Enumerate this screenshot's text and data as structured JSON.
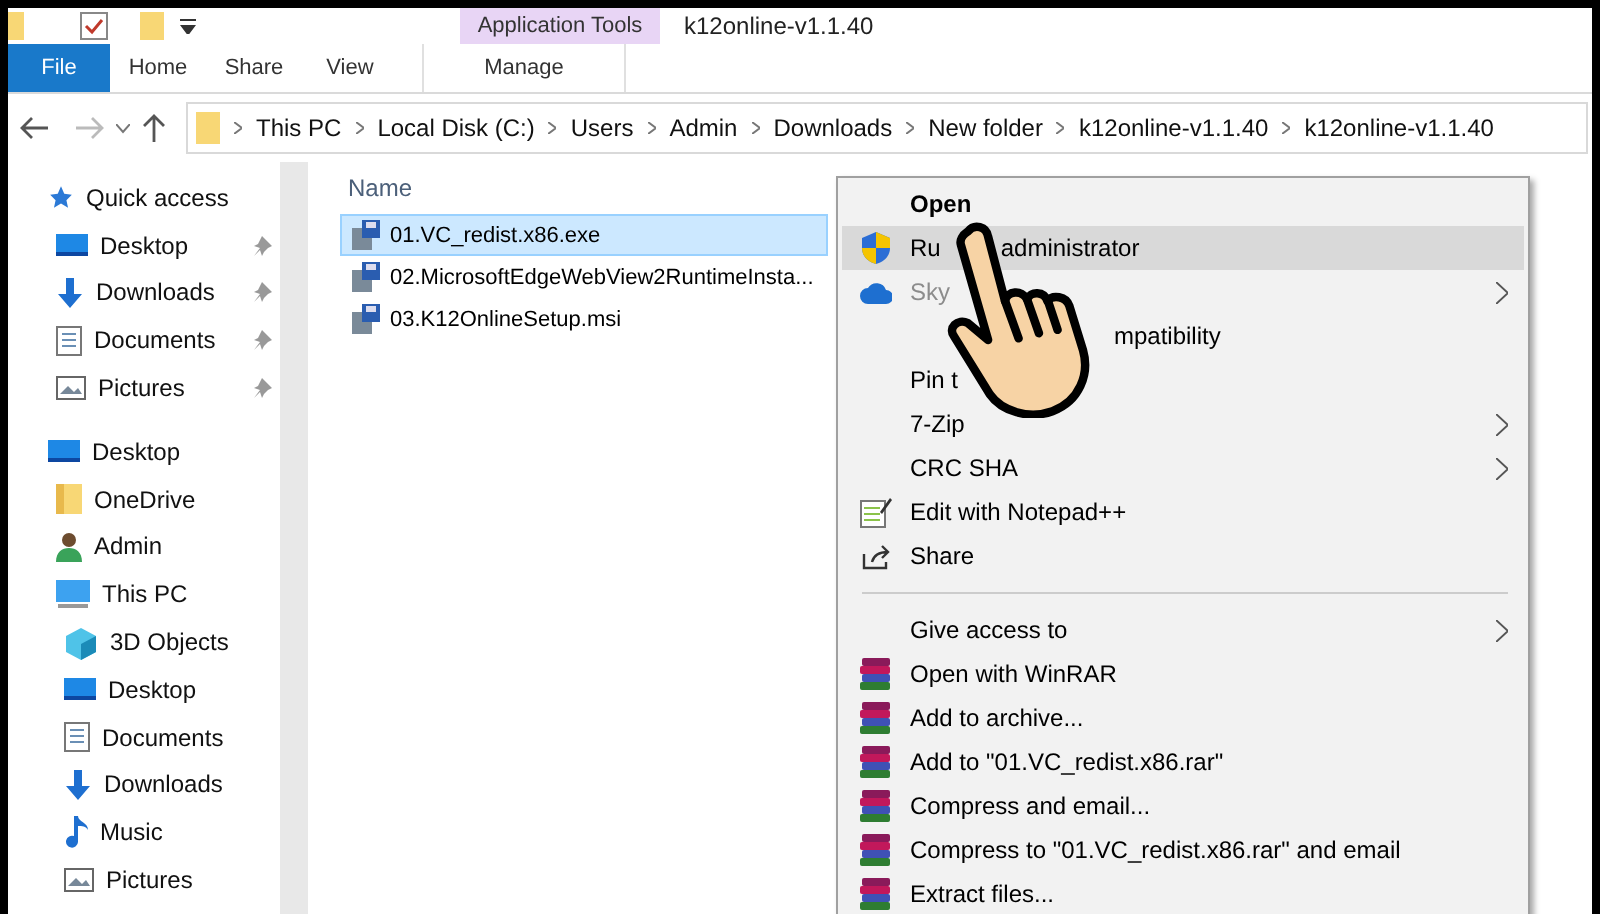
{
  "window": {
    "title": "k12online-v1.1.40",
    "context_tab": "Application Tools"
  },
  "ribbon_tabs": [
    {
      "label": "File",
      "kind": "file",
      "selected": false
    },
    {
      "label": "Home",
      "kind": "plain",
      "selected": false
    },
    {
      "label": "Share",
      "kind": "plain",
      "selected": false
    },
    {
      "label": "View",
      "kind": "plain",
      "selected": false
    },
    {
      "label": "Manage",
      "kind": "context",
      "selected": false
    }
  ],
  "address_bar": {
    "crumbs": [
      "This PC",
      "Local Disk (C:)",
      "Users",
      "Admin",
      "Downloads",
      "New folder",
      "k12online-v1.1.40",
      "k12online-v1.1.40"
    ]
  },
  "sidebar": {
    "items": [
      {
        "label": "Quick access",
        "kind": "star",
        "children": [
          {
            "label": "Desktop",
            "kind": "desktop",
            "pinned": true
          },
          {
            "label": "Downloads",
            "kind": "download",
            "pinned": true
          },
          {
            "label": "Documents",
            "kind": "document",
            "pinned": true
          },
          {
            "label": "Pictures",
            "kind": "picture",
            "pinned": true
          }
        ]
      },
      {
        "label": "Desktop",
        "kind": "desktop",
        "children": [
          {
            "label": "OneDrive",
            "kind": "folder"
          },
          {
            "label": "Admin",
            "kind": "person"
          },
          {
            "label": "This PC",
            "kind": "pc",
            "children": [
              {
                "label": "3D Objects",
                "kind": "cube"
              },
              {
                "label": "Desktop",
                "kind": "desktop"
              },
              {
                "label": "Documents",
                "kind": "document"
              },
              {
                "label": "Downloads",
                "kind": "download"
              },
              {
                "label": "Music",
                "kind": "music"
              },
              {
                "label": "Pictures",
                "kind": "picture"
              }
            ]
          }
        ]
      }
    ]
  },
  "file_list": {
    "columns": [
      "Name"
    ],
    "rows": [
      {
        "name": "01.VC_redist.x86.exe",
        "selected": true
      },
      {
        "name": "02.MicrosoftEdgeWebView2RuntimeInsta...",
        "selected": false
      },
      {
        "name": "03.K12OnlineSetup.msi",
        "selected": false
      }
    ]
  },
  "context_menu": {
    "items": [
      {
        "kind": "plain",
        "label": "Open",
        "default": true
      },
      {
        "kind": "shield",
        "label": "Ru",
        "tail": "administrator",
        "highlighted": true
      },
      {
        "kind": "cloud",
        "label": "Sky",
        "disabled": true,
        "submenu": true
      },
      {
        "kind": "plain",
        "tail": "mpatibility"
      },
      {
        "kind": "plain",
        "label": "Pin t"
      },
      {
        "kind": "plain",
        "label": "7-Zip",
        "submenu": true
      },
      {
        "kind": "plain",
        "label": "CRC SHA",
        "submenu": true
      },
      {
        "kind": "notepad",
        "label": "Edit with Notepad++"
      },
      {
        "kind": "share",
        "label": "Share"
      },
      {
        "kind": "separator"
      },
      {
        "kind": "plain",
        "label": "Give access to",
        "submenu": true
      },
      {
        "kind": "winrar",
        "label": "Open with WinRAR"
      },
      {
        "kind": "winrar",
        "label": "Add to archive..."
      },
      {
        "kind": "winrar",
        "label": "Add to \"01.VC_redist.x86.rar\""
      },
      {
        "kind": "winrar",
        "label": "Compress and email..."
      },
      {
        "kind": "winrar",
        "label": "Compress to \"01.VC_redist.x86.rar\" and email"
      },
      {
        "kind": "winrar",
        "label": "Extract files..."
      }
    ]
  }
}
